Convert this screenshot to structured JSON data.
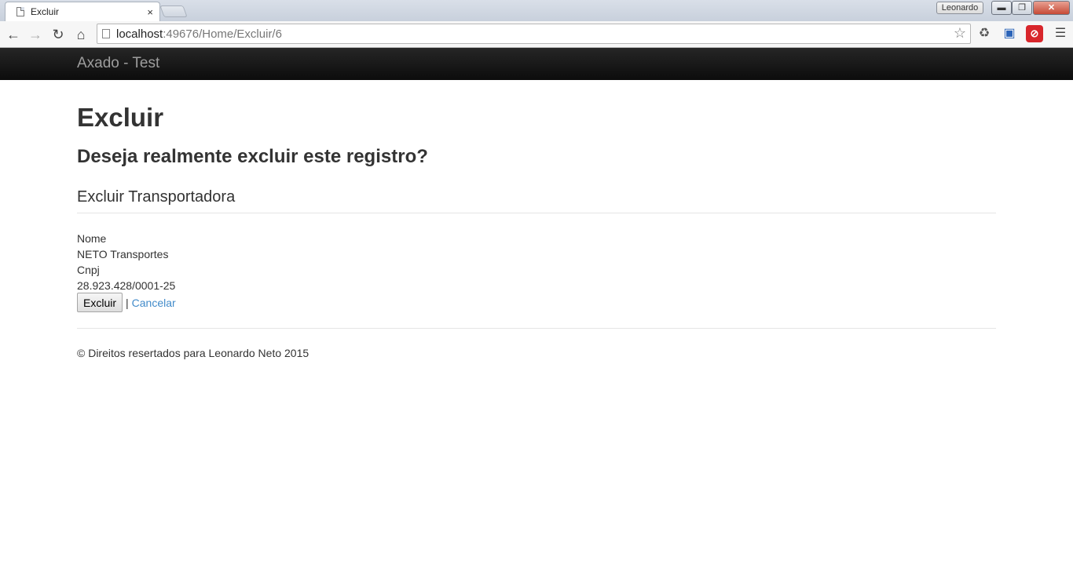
{
  "browser": {
    "tab_title": "Excluir",
    "tab_close": "×",
    "profile_name": "Leonardo",
    "window_min": "▬",
    "window_max": "❐",
    "window_close": "✕",
    "url_host": "localhost",
    "url_path": ":49676/Home/Excluir/6",
    "icons": {
      "back": "back-arrow-icon",
      "forward": "forward-arrow-icon",
      "reload": "reload-icon",
      "home": "home-icon",
      "star": "bookmark-star-icon",
      "recycle": "recycle-icon",
      "screen": "screen-capture-icon",
      "block": "adblock-icon",
      "menu": "menu-icon"
    }
  },
  "navbar": {
    "brand": "Axado - Test"
  },
  "main": {
    "title": "Excluir",
    "question": "Deseja realmente excluir este registro?",
    "section_title": "Excluir Transportadora",
    "fields": [
      {
        "label": "Nome",
        "value": "NETO Transportes"
      },
      {
        "label": "Cnpj",
        "value": "28.923.428/0001-25"
      }
    ],
    "submit_label": "Excluir",
    "separator": "|",
    "cancel_label": "Cancelar"
  },
  "footer": {
    "text": "© Direitos resertados para Leonardo Neto 2015"
  },
  "colors": {
    "navbar_bg": "#111111",
    "brand_text": "#9d9d9d",
    "link": "#428bca",
    "text": "#333333"
  }
}
